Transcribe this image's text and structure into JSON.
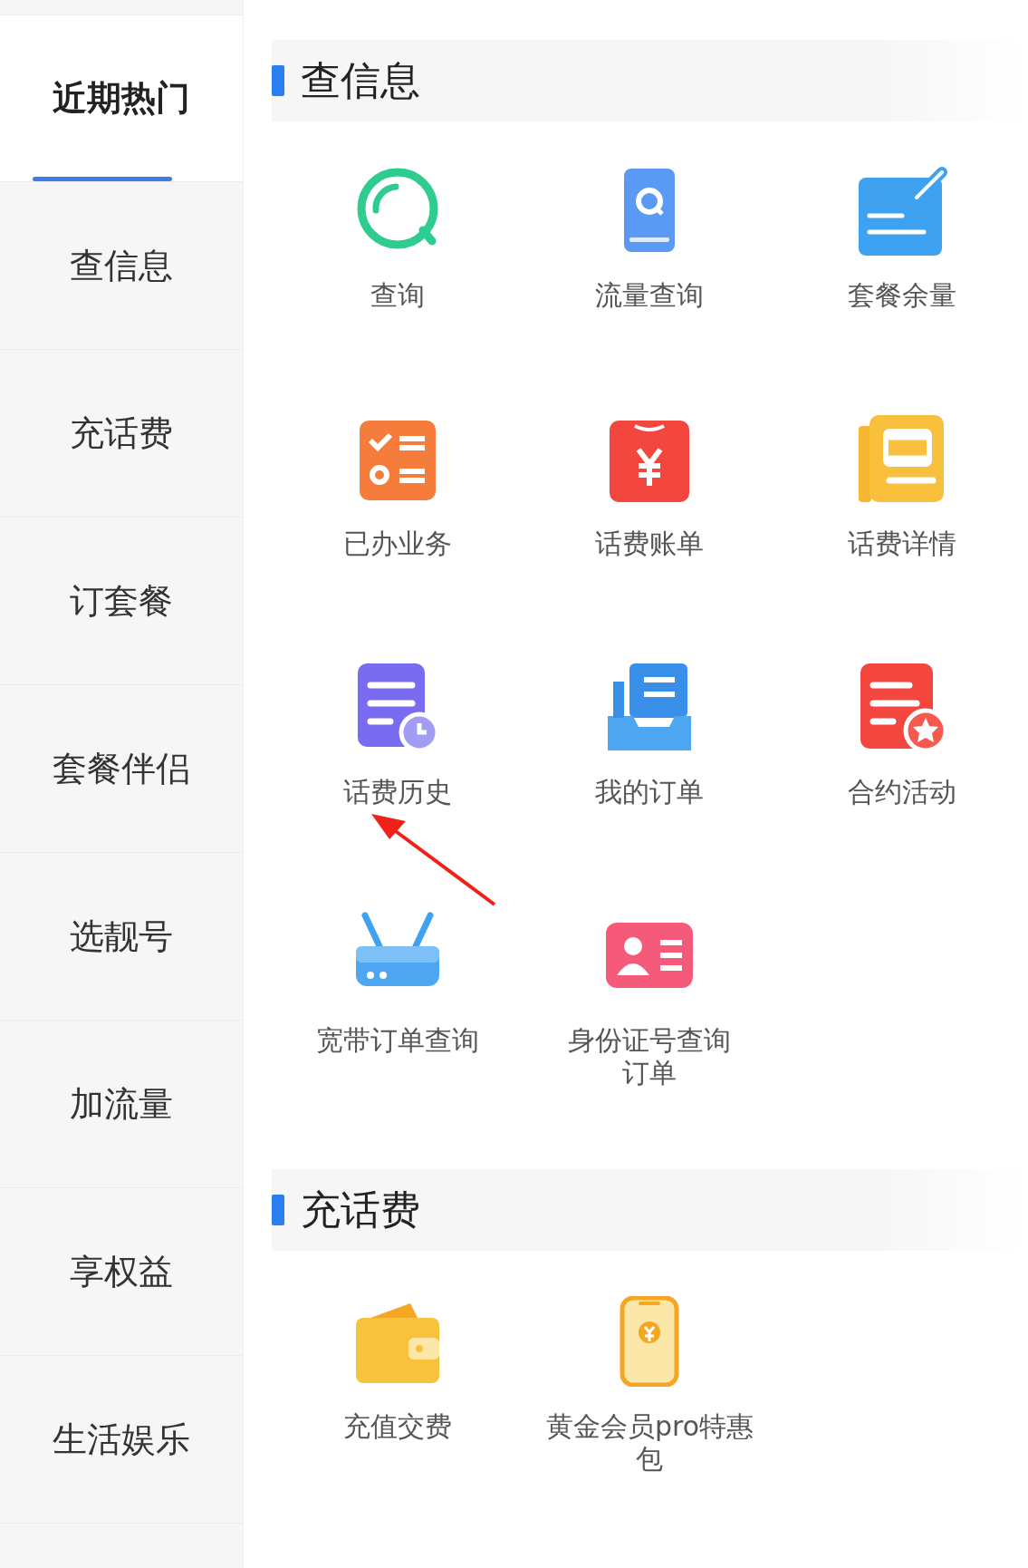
{
  "sidebar": {
    "items": [
      {
        "label": "近期热门",
        "selected": true
      },
      {
        "label": "查信息",
        "selected": false
      },
      {
        "label": "充话费",
        "selected": false
      },
      {
        "label": "订套餐",
        "selected": false
      },
      {
        "label": "套餐伴侣",
        "selected": false
      },
      {
        "label": "选靓号",
        "selected": false
      },
      {
        "label": "加流量",
        "selected": false
      },
      {
        "label": "享权益",
        "selected": false
      },
      {
        "label": "生活娱乐",
        "selected": false
      }
    ]
  },
  "sections": [
    {
      "title": "查信息",
      "items": [
        {
          "label": [
            "查询"
          ]
        },
        {
          "label": [
            "流量查询"
          ]
        },
        {
          "label": [
            "套餐余量"
          ]
        },
        {
          "label": [
            "已办业务"
          ]
        },
        {
          "label": [
            "话费账单"
          ]
        },
        {
          "label": [
            "话费详情"
          ]
        },
        {
          "label": [
            "话费历史"
          ]
        },
        {
          "label": [
            "我的订单"
          ]
        },
        {
          "label": [
            "合约活动"
          ]
        },
        {
          "label": [
            "宽带订单查询"
          ]
        },
        {
          "label": [
            "身份证号查询",
            "订单"
          ]
        }
      ]
    },
    {
      "title": "充话费",
      "items": [
        {
          "label": [
            "充值交费"
          ]
        },
        {
          "label": [
            "黄金会员pro特惠",
            "包"
          ]
        }
      ]
    }
  ],
  "annotation": {
    "kind": "arrow"
  }
}
